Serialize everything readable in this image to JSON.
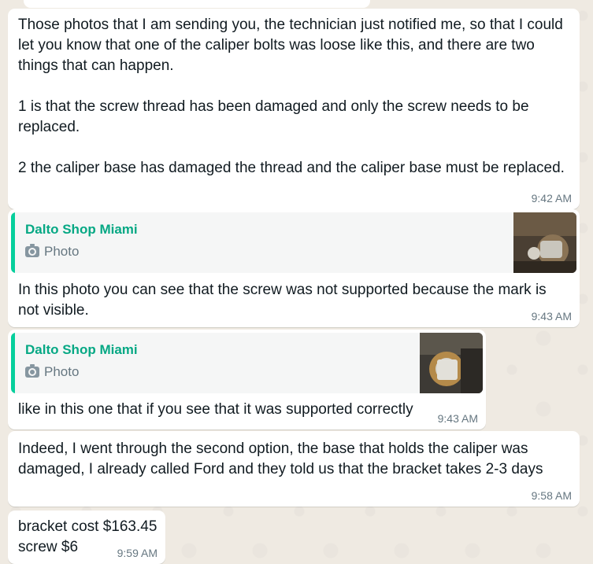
{
  "messages": [
    {
      "text": "Those photos that I am sending you, the technician just notified me, so that I could let you know that one of the caliper bolts was loose like this, and there are two things that can happen.\n\n1 is that the screw thread has been damaged and only the screw needs to be replaced.\n\n2 the caliper base has damaged the thread and the caliper base must be replaced.",
      "time": "9:42 AM"
    },
    {
      "quote_name": "Dalto Shop Miami",
      "quote_type": "Photo",
      "text": "In this photo you can see that the screw was not supported because the mark is not visible.",
      "time": "9:43 AM"
    },
    {
      "quote_name": "Dalto Shop Miami",
      "quote_type": "Photo",
      "text": "like in this one that if you see that it was supported correctly",
      "time": "9:43 AM"
    },
    {
      "text": "Indeed, I went through the second option, the base that holds the caliper was damaged, I already called Ford and they told us that the bracket takes 2-3 days",
      "time": "9:58 AM"
    },
    {
      "text": "bracket cost $163.45\nscrew $6",
      "time": "9:59 AM"
    }
  ],
  "colors": {
    "background": "#efeae2",
    "bubble": "#ffffff",
    "quote_accent": "#06cf9c",
    "quote_name": "#06a884",
    "timestamp": "#667781"
  },
  "icons": [
    "camera-icon"
  ]
}
